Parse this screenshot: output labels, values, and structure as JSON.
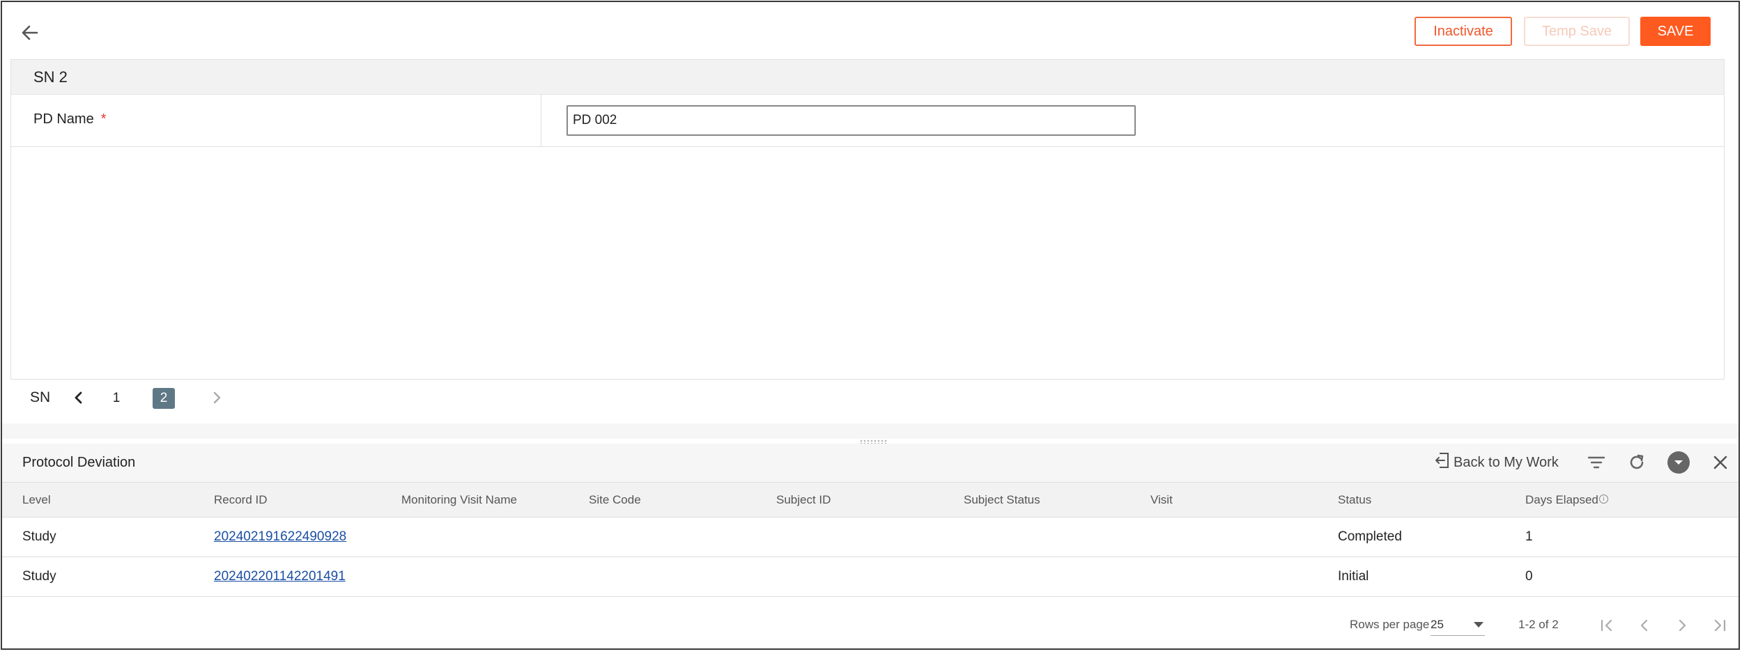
{
  "toolbar": {
    "inactivate_label": "Inactivate",
    "temp_save_label": "Temp Save",
    "save_label": "SAVE"
  },
  "form": {
    "section_title": "SN 2",
    "pd_name_label": "PD Name",
    "required_mark": "*",
    "pd_name_value": "PD 002"
  },
  "sn_pager": {
    "label": "SN",
    "pages": [
      "1",
      "2"
    ],
    "current": "2"
  },
  "panel": {
    "title": "Protocol Deviation",
    "back_to_work_label": "Back to My Work"
  },
  "table": {
    "columns": [
      "Level",
      "Record ID",
      "Monitoring Visit Name",
      "Site Code",
      "Subject ID",
      "Subject Status",
      "Visit",
      "Status",
      "Days Elapsed"
    ],
    "rows": [
      {
        "level": "Study",
        "record_id": "202402191622490928",
        "monitoring_visit_name": "",
        "site_code": "",
        "subject_id": "",
        "subject_status": "",
        "visit": "",
        "status": "Completed",
        "days_elapsed": "1"
      },
      {
        "level": "Study",
        "record_id": "202402201142201491",
        "monitoring_visit_name": "",
        "site_code": "",
        "subject_id": "",
        "subject_status": "",
        "visit": "",
        "status": "Initial",
        "days_elapsed": "0"
      }
    ]
  },
  "footer": {
    "rows_per_page_label": "Rows per page",
    "rows_per_page_value": "25",
    "range_text": "1-2 of 2"
  },
  "colors": {
    "accent": "#ff5a1f",
    "accent_border": "#f26a3d",
    "disabled_border": "#f7dcd2",
    "active_page": "#5f7886",
    "link": "#1a4fa3"
  },
  "icons": [
    "back-arrow-icon",
    "chevron-left-icon",
    "chevron-right-icon",
    "back-to-work-icon",
    "filter-icon",
    "refresh-icon",
    "expand-icon",
    "close-icon",
    "first-page-icon",
    "prev-page-icon",
    "next-page-icon",
    "last-page-icon",
    "info-icon",
    "drag-handle-icon"
  ]
}
